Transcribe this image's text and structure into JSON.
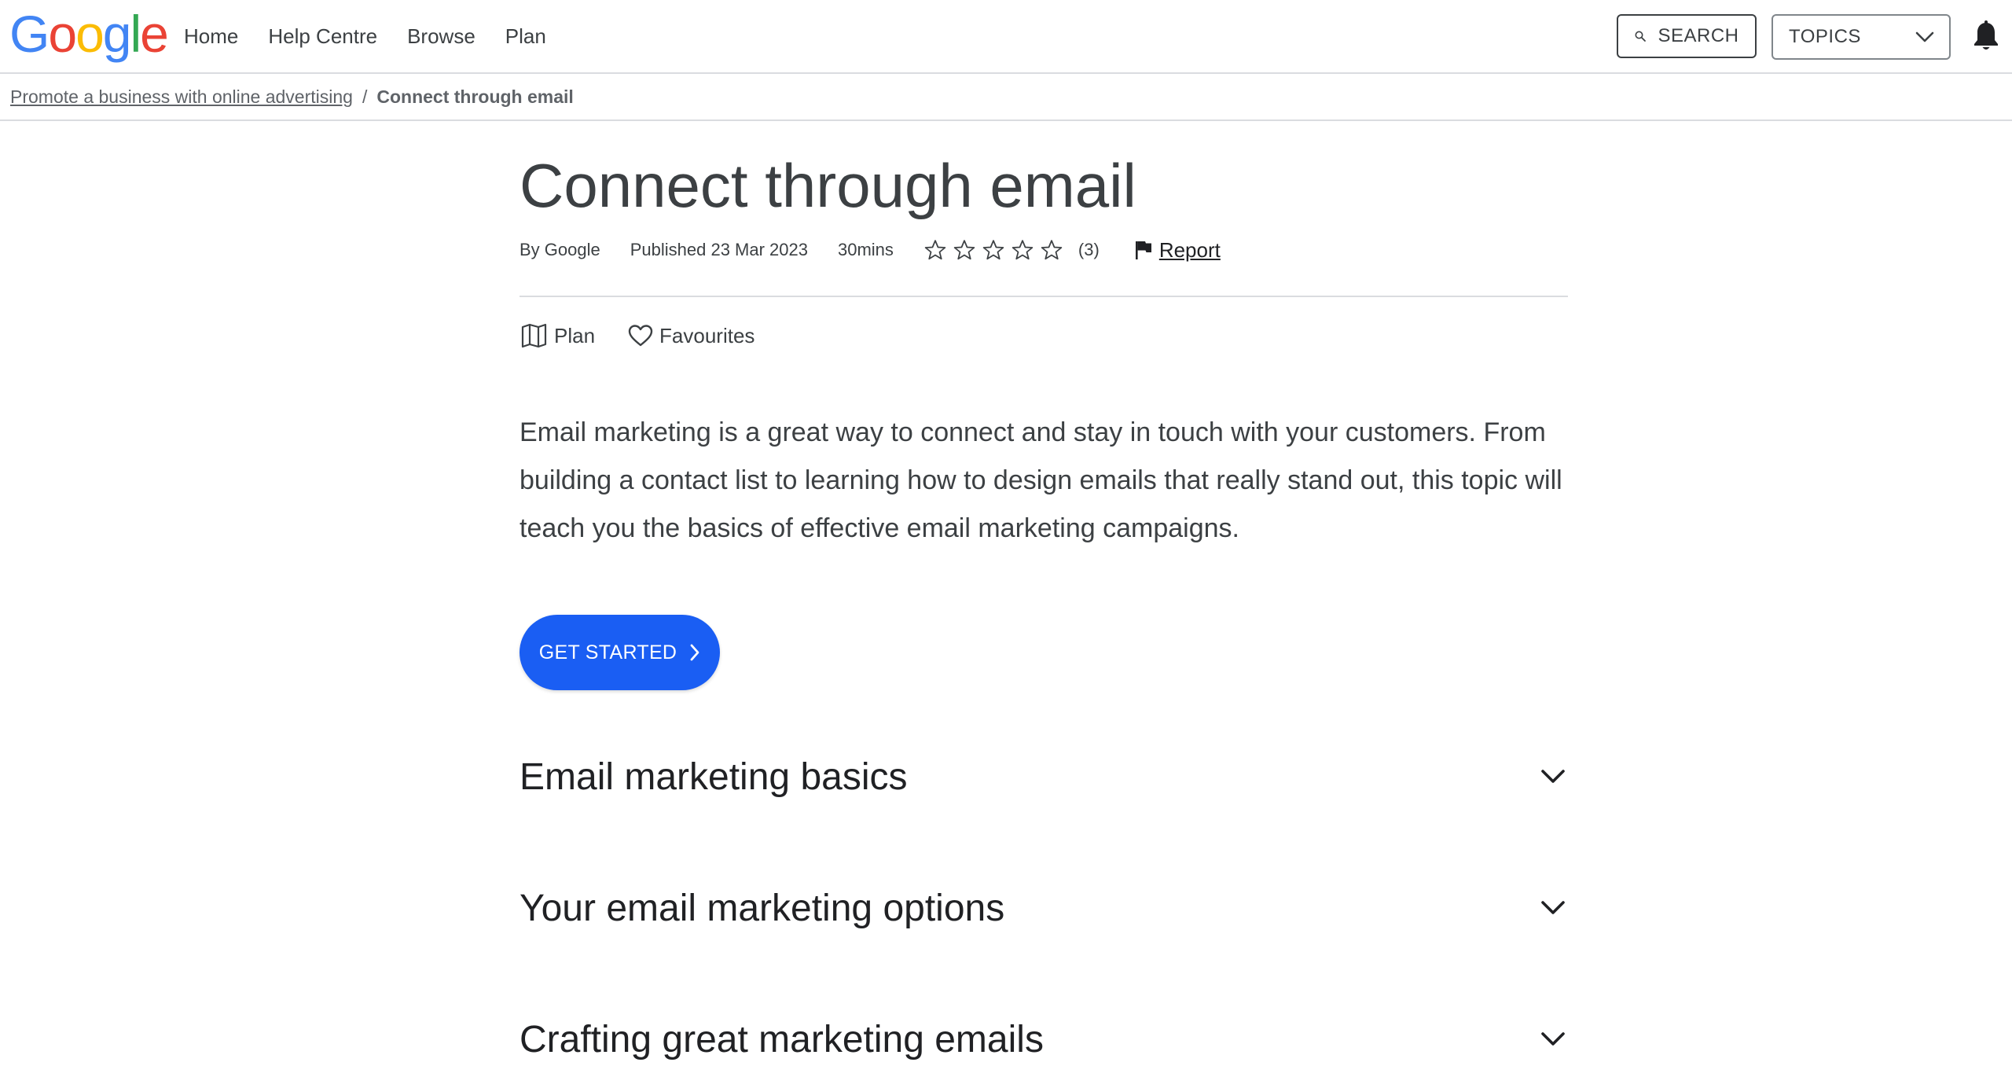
{
  "header": {
    "logo": {
      "letters": [
        "G",
        "o",
        "o",
        "g",
        "l",
        "e"
      ],
      "colors": [
        "#4285F4",
        "#EA4335",
        "#FBBC05",
        "#4285F4",
        "#34A853",
        "#EA4335"
      ]
    },
    "nav": [
      "Home",
      "Help Centre",
      "Browse",
      "Plan"
    ],
    "search_label": "SEARCH",
    "topics_label": "TOPICS"
  },
  "breadcrumb": {
    "parent": "Promote a business with online advertising",
    "separator": "/",
    "current": "Connect through email"
  },
  "article": {
    "title": "Connect through email",
    "author": "By Google",
    "published": "Published 23 Mar 2023",
    "duration": "30mins",
    "rating": {
      "stars_filled": 0,
      "stars_total": 5,
      "count": "(3)"
    },
    "report_label": "Report",
    "actions": {
      "plan_label": "Plan",
      "favourites_label": "Favourites"
    },
    "intro": "Email marketing is a great way to connect and stay in touch with your customers. From building a contact list to learning how to design emails that really stand out, this topic will teach you the basics of effective email marketing campaigns.",
    "cta_label": "GET STARTED",
    "sections": [
      "Email marketing basics",
      "Your email marketing options",
      "Crafting great marketing emails"
    ]
  },
  "colors": {
    "accent": "#1a5ef3",
    "text": "#3c4043",
    "divider": "#dadce0"
  }
}
